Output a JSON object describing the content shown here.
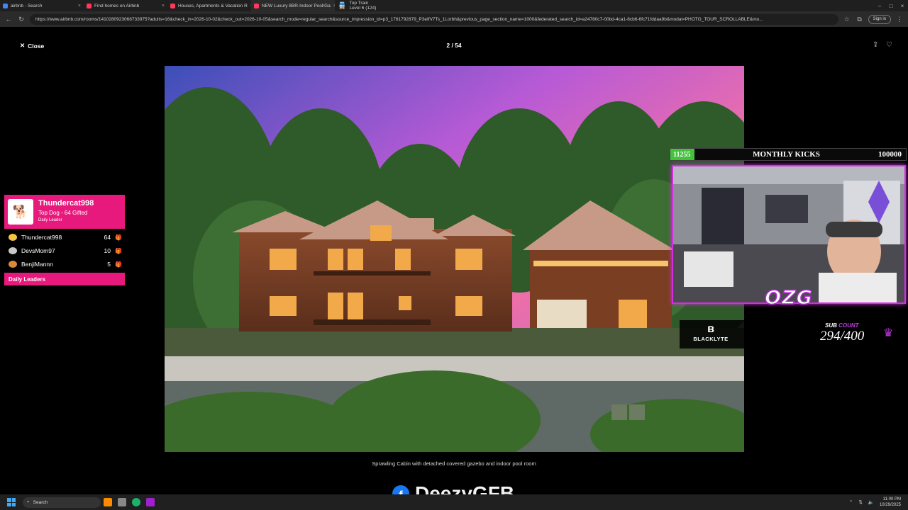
{
  "browser": {
    "tabs": [
      {
        "label": "airbnb - Search",
        "color": "#4285f4"
      },
      {
        "label": "Find homes on Airbnb",
        "color": "#ff385c"
      },
      {
        "label": "Houses, Apartments & Vacation R",
        "color": "#ff385c"
      },
      {
        "label": "NEW Luxury 8BR-Indoor Pool/Ga",
        "color": "#ff385c"
      },
      {
        "label": "Top Train",
        "sublabel": "Level 6 (124)"
      }
    ],
    "url": "https://www.airbnb.com/rooms/1410280923068733975?adults=16&check_in=2026-10-02&check_out=2026-10-05&search_mode=regular_search&source_impression_id=p3_1761792879_P3eIfV7Ts_1Lorbh&previous_page_section_name=1000&federated_search_id=a24780c7-00bd-4ca1-8cb6-6fc71fddaa9b&modal=PHOTO_TOUR_SCROLLABLE&mo...",
    "sign_in": "Sign in"
  },
  "photo_page": {
    "close_label": "Close",
    "counter": "2 / 54",
    "caption": "Sprawling Cabin with detached covered gazebo and indoor pool room"
  },
  "leaderboard": {
    "top_name": "Thundercat998",
    "top_subtitle": "Top Dog - 64 Gifted",
    "top_tag": "Daily Leader",
    "rows": [
      {
        "name": "Thundercat998",
        "count": "64",
        "medal_color": "#f5c542",
        "gift_color": "#ff4d9a"
      },
      {
        "name": "DevsMom97",
        "count": "10",
        "medal_color": "#c8c8c8",
        "gift_color": "#3fd0ff"
      },
      {
        "name": "BenjiMannn",
        "count": "5",
        "medal_color": "#d98a3a",
        "gift_color": "#3fd0ff"
      }
    ],
    "footer": "Daily Leaders",
    "accent": "#e8197d"
  },
  "kicks": {
    "current": "11255",
    "title": "MONTHLY KICKS",
    "goal": "100000",
    "progress": 0.11255
  },
  "sub_panel": {
    "brand": "BLACKLYTE",
    "label_a": "SUB",
    "label_b": "COUNT",
    "count": "294/400"
  },
  "ozg_text": "OZG",
  "watermark": "DeezyGFB",
  "taskbar": {
    "search": "Search",
    "time": "11:00 PM",
    "date": "10/29/2025"
  }
}
